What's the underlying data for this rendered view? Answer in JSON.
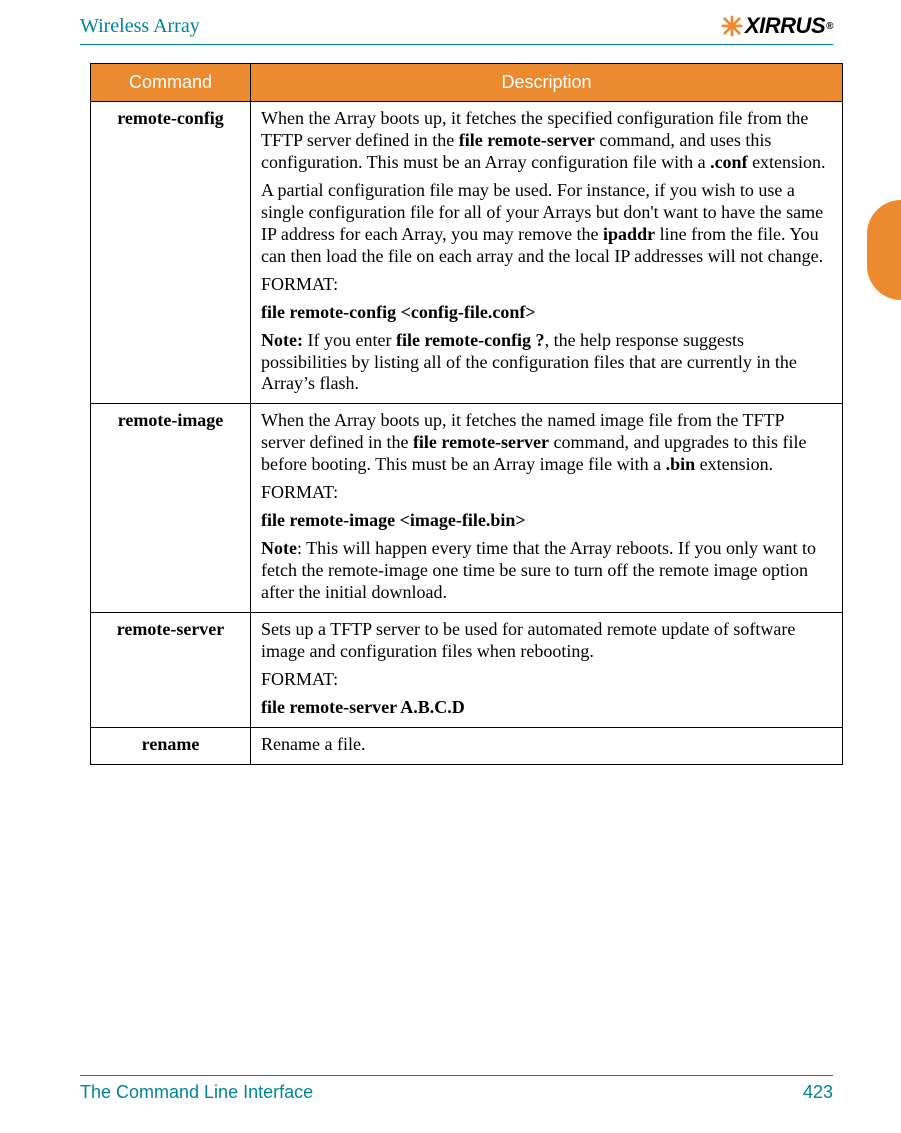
{
  "header": {
    "title": "Wireless Array",
    "logo_text": "XIRRUS",
    "logo_reg": "®"
  },
  "side_tab_color": "#ec8a2f",
  "table": {
    "head": {
      "c1": "Command",
      "c2": "Description"
    },
    "rows": [
      {
        "cmd": "remote-config",
        "p1a": "When the Array boots up, it fetches the specified configuration file from the TFTP server defined in the ",
        "p1b": "file remote-server",
        "p1c": " command, and uses this configuration. This must be an Array configuration file with a ",
        "p1d": ".conf",
        "p1e": " extension.",
        "p2a": "A partial configuration file may be used. For instance, if you wish to use a single configuration file for all of your Arrays but don't want to have the same IP address for each Array, you may remove the ",
        "p2b": "ipaddr",
        "p2c": " line from the file. You can then load the file on each array and the local IP addresses will not change.",
        "p3": "FORMAT:",
        "p4": "file remote-config <config-file.conf>",
        "p5a": "Note:",
        "p5b": " If you enter ",
        "p5c": "file remote-config ?",
        "p5d": ", the help response suggests possibilities by listing all of the configuration files that are currently in the Array’s flash."
      },
      {
        "cmd": "remote-image",
        "p1a": "When the Array boots up, it fetches the named image file from the TFTP server defined in the ",
        "p1b": "file remote-server",
        "p1c": " command, and upgrades to this file before booting. This must be an Array image file with a ",
        "p1d": ".bin",
        "p1e": " extension.",
        "p2": "FORMAT:",
        "p3": "file remote-image <image-file.bin>",
        "p4a": "Note",
        "p4b": ": This will happen every time that the Array reboots. If you only want to fetch the remote-image one time be sure to turn off the remote image option after the initial download."
      },
      {
        "cmd": "remote-server",
        "p1": "Sets up a TFTP server to be used for automated remote update of software image and configuration files when rebooting.",
        "p2": "FORMAT:",
        "p3": "file remote-server A.B.C.D"
      },
      {
        "cmd": "rename",
        "p1": "Rename a file."
      }
    ]
  },
  "footer": {
    "section": "The Command Line Interface",
    "page": "423"
  }
}
